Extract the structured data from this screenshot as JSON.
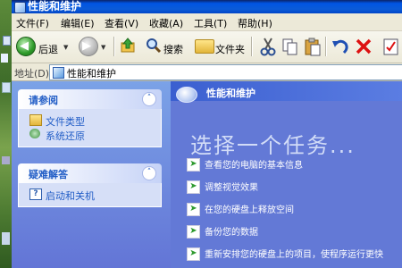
{
  "window": {
    "title": "性能和维护"
  },
  "menu": [
    "文件(F)",
    "编辑(E)",
    "查看(V)",
    "收藏(A)",
    "工具(T)",
    "帮助(H)"
  ],
  "toolbar": {
    "back_label": "后退",
    "search_label": "搜索",
    "folders_label": "文件夹"
  },
  "address": {
    "label": "地址(D)",
    "value": "性能和维护"
  },
  "see_also": {
    "title": "请参阅",
    "items": [
      "文件类型",
      "系统还原"
    ]
  },
  "troubleshoot": {
    "title": "疑难解答",
    "items": [
      "启动和关机"
    ]
  },
  "main": {
    "header": "性能和维护",
    "pick_task": "选择一个任务...",
    "tasks": [
      "查看您的电脑的基本信息",
      "调整视觉效果",
      "在您的硬盘上释放空间",
      "备份您的数据",
      "重新安排您的硬盘上的项目，使程序运行更快"
    ]
  },
  "colors": {
    "titlebar": "#0054e3",
    "left_pane": "#7ba2e7",
    "right_pane": "#6379d6",
    "link": "#215dc6",
    "task_arrow": "#2e9a2e"
  }
}
